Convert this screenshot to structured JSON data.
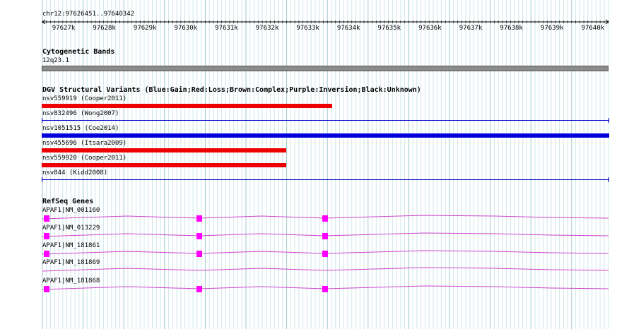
{
  "ruler": {
    "location": "chr12:97626451..97640342",
    "ticks": [
      "97627k",
      "97628k",
      "97629k",
      "97630k",
      "97631k",
      "97632k",
      "97633k",
      "97634k",
      "97635k",
      "97636k",
      "97637k",
      "97638k",
      "97639k",
      "97640k"
    ]
  },
  "cytoband": {
    "title": "Cytogenetic Bands",
    "band": "12q23.1",
    "color": "#8c8c8c"
  },
  "dgv": {
    "title": "DGV Structural Variants (Blue:Gain;Red:Loss;Brown:Complex;Purple:Inversion;Black:Unknown)",
    "variants": [
      {
        "label": "nsv559919 (Cooper2011)",
        "type": "Loss",
        "color": "#ee0000"
      },
      {
        "label": "nsv832496 (Wong2007)",
        "type": "Gain",
        "color": "#0000cc"
      },
      {
        "label": "nsv1051515 (Coe2014)",
        "type": "Gain",
        "color": "#0000dd"
      },
      {
        "label": "nsv455696 (Itsara2009)",
        "type": "Loss",
        "color": "#ee0000"
      },
      {
        "label": "nsv559920 (Cooper2011)",
        "type": "Loss",
        "color": "#ee0000"
      },
      {
        "label": "nsv844 (Kidd2008)",
        "type": "Gain",
        "color": "#0000cc"
      }
    ]
  },
  "refseq": {
    "title": "RefSeq Genes",
    "color": "#ff00ff",
    "intron_color": "#cc44cc",
    "genes": [
      {
        "label": "APAF1|NM_001160",
        "has_exons": true
      },
      {
        "label": "APAF1|NM_013229",
        "has_exons": true
      },
      {
        "label": "APAF1|NM_181861",
        "has_exons": true
      },
      {
        "label": "APAF1|NM_181869",
        "has_exons": false
      },
      {
        "label": "APAF1|NM_181868",
        "has_exons": true
      }
    ]
  }
}
